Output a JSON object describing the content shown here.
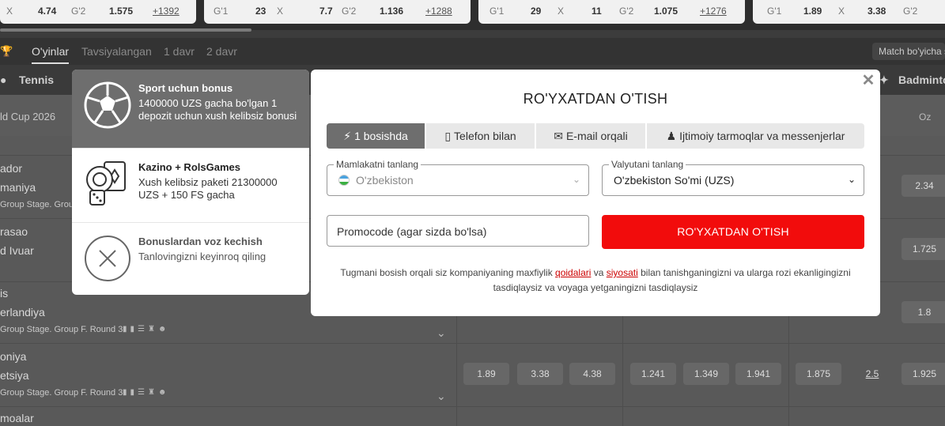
{
  "ticker": {
    "cards": [
      {
        "items": [
          {
            "t": "X",
            "c": "lbl"
          },
          {
            "t": "4.74",
            "c": "b"
          },
          {
            "t": "G'2",
            "c": "lbl"
          },
          {
            "t": "1.575",
            "c": "b"
          },
          {
            "t": "+1392",
            "c": "more"
          }
        ]
      },
      {
        "items": [
          {
            "t": "G'1",
            "c": "lbl"
          },
          {
            "t": "23",
            "c": "b"
          },
          {
            "t": "X",
            "c": "lbl"
          },
          {
            "t": "7.7",
            "c": "b"
          },
          {
            "t": "G'2",
            "c": "lbl"
          },
          {
            "t": "1.136",
            "c": "b"
          },
          {
            "t": "+1288",
            "c": "more"
          }
        ]
      },
      {
        "items": [
          {
            "t": "G'1",
            "c": "lbl"
          },
          {
            "t": "29",
            "c": "b"
          },
          {
            "t": "X",
            "c": "lbl"
          },
          {
            "t": "11",
            "c": "b"
          },
          {
            "t": "G'2",
            "c": "lbl"
          },
          {
            "t": "1.075",
            "c": "b"
          },
          {
            "t": "+1276",
            "c": "more"
          }
        ]
      },
      {
        "items": [
          {
            "t": "G'1",
            "c": "lbl"
          },
          {
            "t": "1.89",
            "c": "b"
          },
          {
            "t": "X",
            "c": "lbl"
          },
          {
            "t": "3.38",
            "c": "b"
          },
          {
            "t": "G'2",
            "c": "lbl"
          }
        ]
      }
    ]
  },
  "nav": {
    "tabs": [
      "O'yinlar",
      "Tavsiyalangan",
      "1 davr",
      "2 davr"
    ],
    "match_select": "Match bo'yicha s"
  },
  "sports": {
    "left": "Tennis",
    "right": "Badminto"
  },
  "list": {
    "tournament": "ld Cup 2026",
    "oz_label": "Oz",
    "rows": [
      {
        "t1": "ador",
        "t2": "maniya",
        "group": "Group Stage. Group",
        "odds": [
          "2.34"
        ]
      },
      {
        "t1": "rasao",
        "t2": "d Ivuar",
        "group": "",
        "odds": [
          "1.725"
        ]
      },
      {
        "t1": "is",
        "t2": "erlandiya",
        "group": "Group Stage. Group F. Round 3",
        "odds": [
          "1.8"
        ]
      },
      {
        "t1": "oniya",
        "t2": "etsiya",
        "group": "Group Stage. Group F. Round 3",
        "odds": [
          "1.89",
          "3.38",
          "4.38",
          "1.241",
          "1.349",
          "1.941",
          "1.875",
          "2.5",
          "1.925"
        ]
      },
      {
        "t1": "moalar",
        "t2": "",
        "group": "",
        "odds": []
      }
    ]
  },
  "bonus": {
    "items": [
      {
        "title": "Sport uchun bonus",
        "desc": "1400000 UZS gacha bo'lgan 1 depozit uchun xush kelibsiz bonusi",
        "icon": "soccer-ball-icon"
      },
      {
        "title": "Kazino + RolsGames",
        "desc": "Xush kelibsiz paketi 21300000 UZS + 150 FS gacha",
        "icon": "casino-chips-dice-icon"
      },
      {
        "title": "Bonuslardan voz kechish",
        "desc": "Tanlovingizni keyinroq qiling",
        "icon": "decline-x-icon"
      }
    ]
  },
  "modal": {
    "title": "RO'YXATDAN O'TISH",
    "tabs": [
      {
        "label": "1 bosishda",
        "icon": "lightning-icon"
      },
      {
        "label": "Telefon bilan",
        "icon": "phone-icon"
      },
      {
        "label": "E-mail orqali",
        "icon": "envelope-icon"
      },
      {
        "label": "Ijtimoiy tarmoqlar va messenjerlar",
        "icon": "users-icon"
      }
    ],
    "country_label": "Mamlakatni tanlang",
    "country_value": "O'zbekiston",
    "currency_label": "Valyutani tanlang",
    "currency_value": "O'zbekiston So'mi (UZS)",
    "promo_placeholder": "Promocode (agar sizda bo'lsa)",
    "register_button": "RO'YXATDAN O'TISH",
    "terms_before": "Tugmani bosish orqali siz kompaniyaning maxfiylik ",
    "terms_link1": "qoidalari",
    "terms_mid": " va ",
    "terms_link2": "siyosati",
    "terms_after": " bilan tanishganingizni va ularga rozi ekanligingizni tasdiqlaysiz va voyaga yetganingizni tasdiqlaysiz"
  },
  "colors": {
    "accent_red": "#f20c0c",
    "selected_bonus": "#6e6e6e",
    "active_tab": "#6e6e6e"
  }
}
